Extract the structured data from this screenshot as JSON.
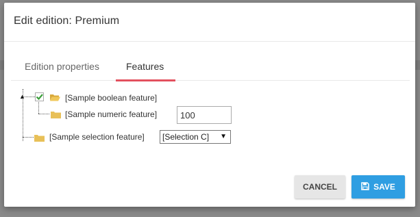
{
  "modal": {
    "title": "Edit edition: Premium"
  },
  "tabs": [
    {
      "label": "Edition properties",
      "active": false
    },
    {
      "label": "Features",
      "active": true
    }
  ],
  "tree": {
    "nodes": [
      {
        "label": "[Sample boolean feature]",
        "checked": true,
        "icon": "folder-open-icon"
      },
      {
        "label": "[Sample numeric feature]",
        "icon": "folder-icon",
        "value": "100"
      },
      {
        "label": "[Sample selection feature]",
        "icon": "folder-icon",
        "selected": "[Selection C]"
      }
    ]
  },
  "buttons": {
    "cancel": "CANCEL",
    "save": "SAVE"
  },
  "colors": {
    "accent": "#e3505e",
    "primary": "#2f9ee2",
    "folder": "#e8c058",
    "check": "#3a9e3a"
  }
}
